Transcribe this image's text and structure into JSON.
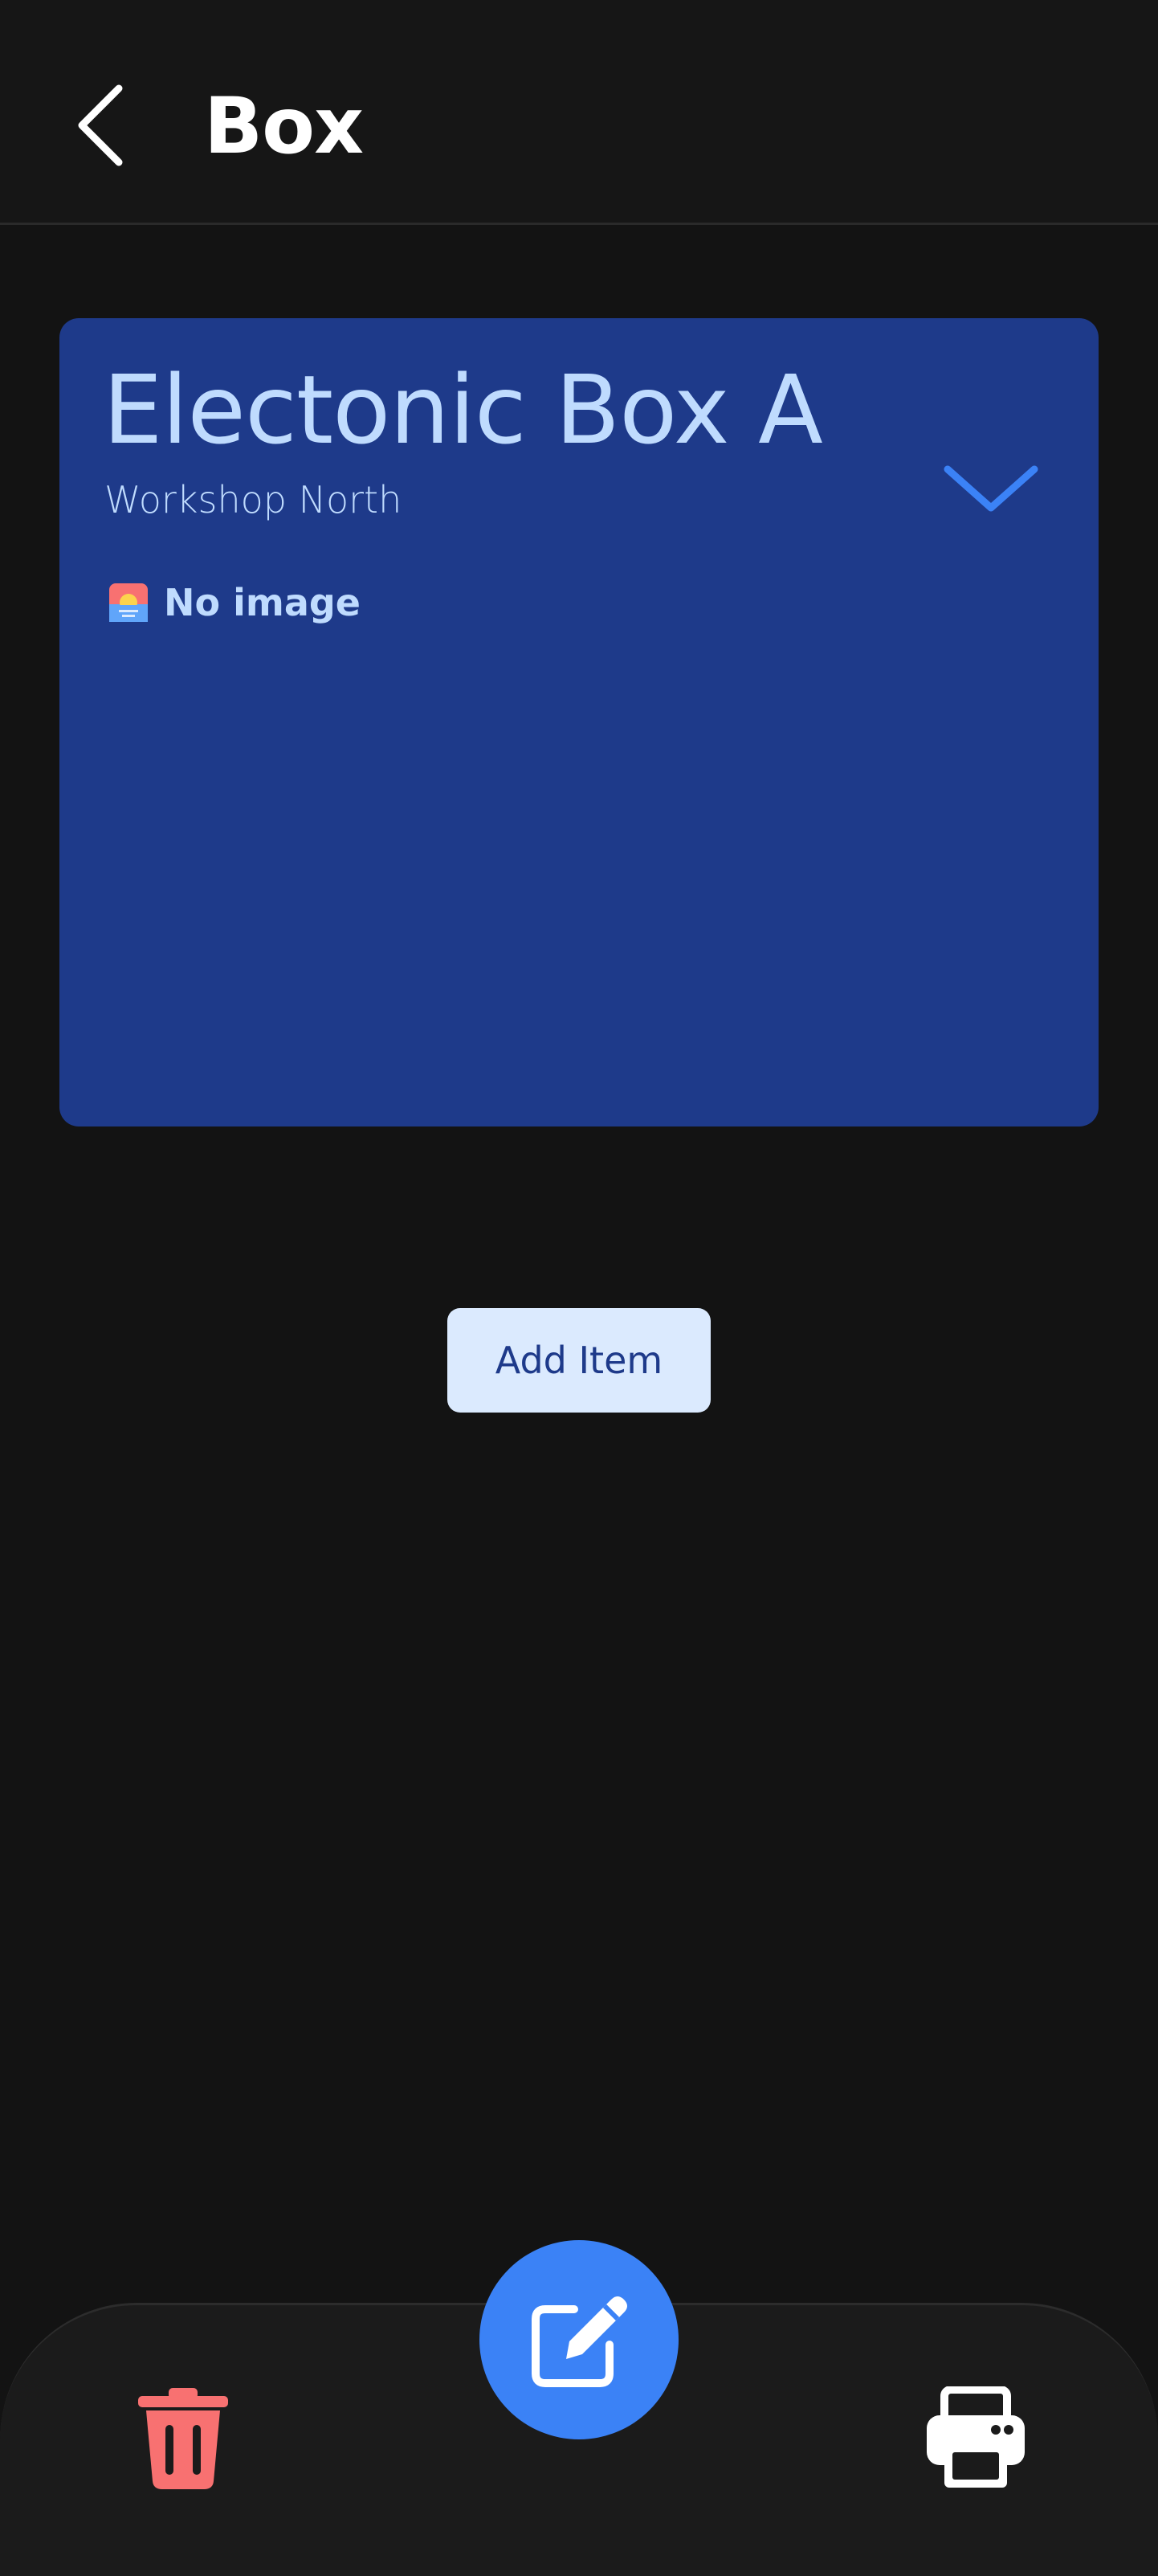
{
  "header": {
    "title": "Box",
    "back_icon": "chevron-left-icon"
  },
  "box": {
    "name": "Electonic Box A",
    "location": "Workshop North",
    "expand_icon": "chevron-down-icon",
    "image_placeholder": {
      "icon": "sunrise-image-icon",
      "label": "No image"
    }
  },
  "actions": {
    "add_item_label": "Add Item"
  },
  "bottom_bar": {
    "delete_icon": "trash-icon",
    "edit_icon": "pencil-square-icon",
    "print_icon": "printer-icon"
  },
  "colors": {
    "background": "#131313",
    "card": "#1e3a8a",
    "card_text": "#bfdbfe",
    "accent": "#3b82f6",
    "button_bg": "#dbeafe",
    "danger": "#f87171"
  }
}
